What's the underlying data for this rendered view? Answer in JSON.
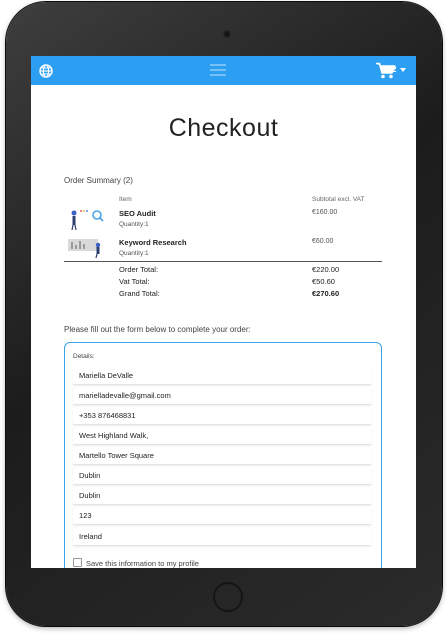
{
  "cart": {
    "count": "2"
  },
  "page": {
    "title": "Checkout"
  },
  "summary": {
    "label": "Order Summary (2)",
    "col_item": "Item",
    "col_subtotal": "Subtotal excl. VAT",
    "items": [
      {
        "name": "SEO Audit",
        "qty": "Quantity:1",
        "price": "€160.00"
      },
      {
        "name": "Keyword Research",
        "qty": "Quantity:1",
        "price": "€60.00"
      }
    ],
    "totals": [
      {
        "label": "Order Total:",
        "value": "€220.00"
      },
      {
        "label": "Vat Total:",
        "value": "€50.60"
      },
      {
        "label": "Grand Total:",
        "value": "€270.60"
      }
    ]
  },
  "form": {
    "intro": "Please fill out the form below to complete your order:",
    "details_label": "Details:",
    "fields": [
      {
        "name": "full-name-field",
        "value": "Mariella DeValle"
      },
      {
        "name": "email-field",
        "value": "marielladevalle@gmail.com"
      },
      {
        "name": "phone-field",
        "value": "+353 876468831"
      },
      {
        "name": "address-line1-field",
        "value": "West Highland Walk,"
      },
      {
        "name": "address-line2-field",
        "value": "Martello Tower Square"
      },
      {
        "name": "city-field",
        "value": "Dublin"
      },
      {
        "name": "county-field",
        "value": "Dublin"
      },
      {
        "name": "postcode-field",
        "value": "123"
      },
      {
        "name": "country-field",
        "value": "Ireland"
      }
    ],
    "save_label": "Save this information to my profile"
  },
  "colors": {
    "accent": "#2d9ff2",
    "form_border": "#39a3e8"
  }
}
